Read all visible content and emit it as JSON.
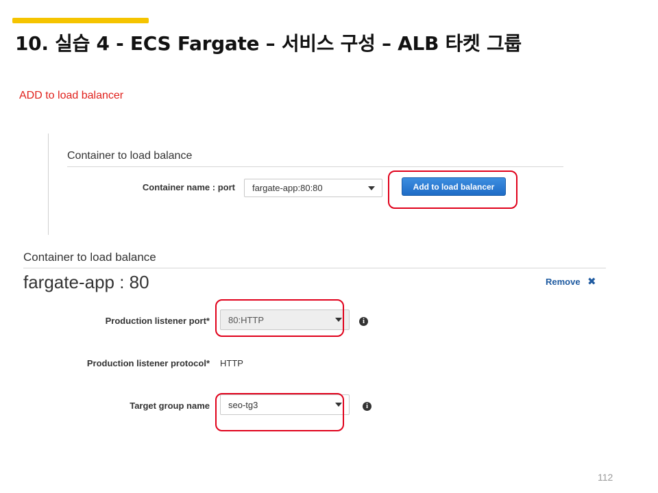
{
  "slide": {
    "title": "10. 실습 4 - ECS Fargate – 서비스 구성 – ALB 타켓 그룹",
    "note": "ADD to load balancer",
    "page_number": "112",
    "accent_color": "#f5c400",
    "highlight_color": "#e0001a"
  },
  "panel_top": {
    "heading": "Container to load balance",
    "container_label": "Container name : port",
    "container_value": "fargate-app:80:80",
    "add_button_label": "Add to load balancer"
  },
  "panel_bottom": {
    "heading": "Container to load balance",
    "app_title": "fargate-app : 80",
    "remove_label": "Remove",
    "listener_port_label": "Production listener port*",
    "listener_port_value": "80:HTTP",
    "listener_protocol_label": "Production listener protocol*",
    "listener_protocol_value": "HTTP",
    "target_group_label": "Target group name",
    "target_group_value": "seo-tg3"
  },
  "icons": {
    "caret": "chevron-down-icon",
    "info": "info-icon",
    "remove": "close-icon"
  }
}
